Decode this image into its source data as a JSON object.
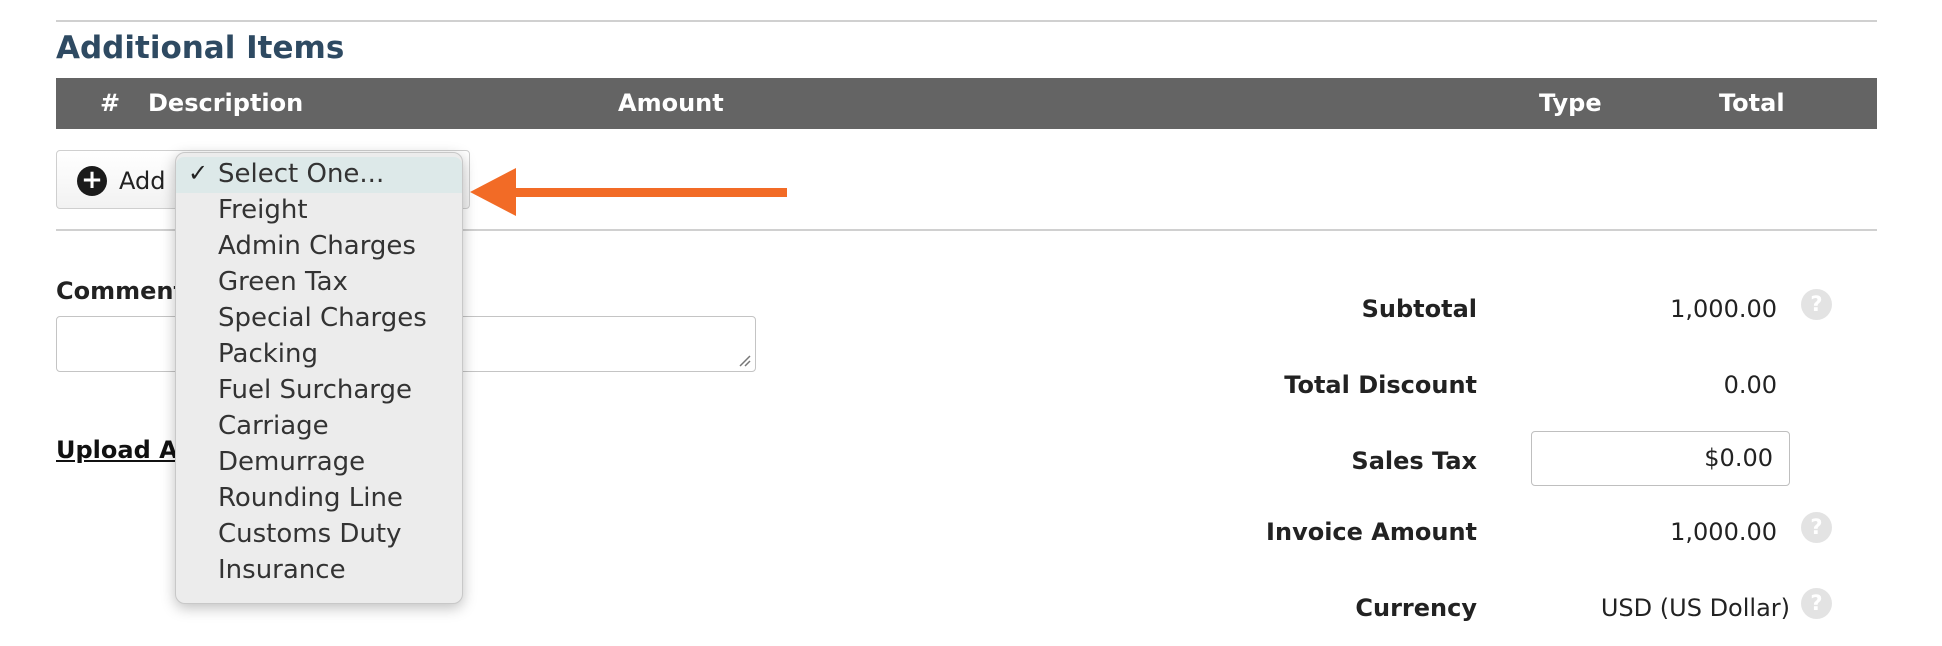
{
  "section": {
    "title": "Additional Items"
  },
  "table": {
    "columns": [
      "#",
      "Description",
      "Amount",
      "Type",
      "Total"
    ]
  },
  "add_button": {
    "label": "Add"
  },
  "dropdown": {
    "check": "✓",
    "selected": "Select One...",
    "options": [
      "Select One...",
      "Freight",
      "Admin Charges",
      "Green Tax",
      "Special Charges",
      "Packing",
      "Fuel Surcharge",
      "Carriage",
      "Demurrage",
      "Rounding Line",
      "Customs Duty",
      "Insurance"
    ]
  },
  "comments": {
    "label": "Comment",
    "value": ""
  },
  "upload": {
    "label": "Upload At"
  },
  "summary": {
    "subtotal_label": "Subtotal",
    "subtotal_value": "1,000.00",
    "discount_label": "Total Discount",
    "discount_value": "0.00",
    "tax_label": "Sales Tax",
    "tax_value": "$0.00",
    "invoice_label": "Invoice Amount",
    "invoice_value": "1,000.00",
    "currency_label": "Currency",
    "currency_value": "USD (US Dollar)",
    "help_glyph": "?"
  },
  "colors": {
    "header_bg": "#646464",
    "title": "#2e4a62",
    "arrow": "#f26b26"
  }
}
